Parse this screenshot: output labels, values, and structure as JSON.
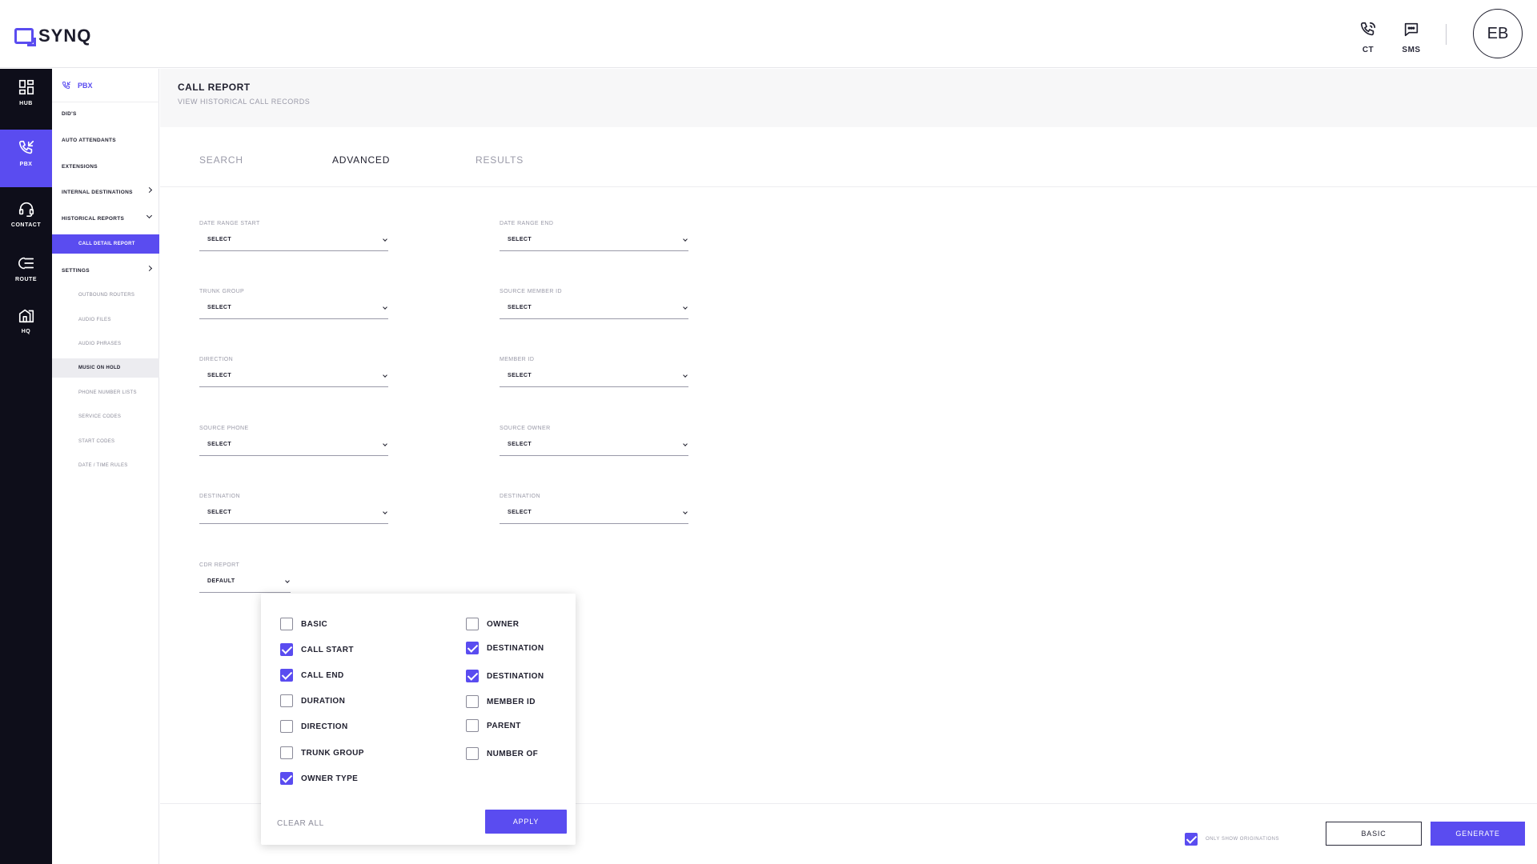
{
  "app": {
    "brand": "SYNQ",
    "brand_color": "#5a4cf0",
    "header_actions": [
      {
        "label": "CT",
        "icon": "phone-icon"
      },
      {
        "label": "SMS",
        "icon": "message-icon"
      }
    ],
    "avatar_initials": "EB"
  },
  "rail": {
    "items": [
      {
        "label": "HUB",
        "icon": "grid-icon",
        "active": false
      },
      {
        "label": "PBX",
        "icon": "incoming-call-icon",
        "active": true
      },
      {
        "label": "CONTACT",
        "icon": "headset-icon",
        "active": false
      },
      {
        "label": "ROUTE",
        "icon": "route-icon",
        "active": false
      },
      {
        "label": "HQ",
        "icon": "building-icon",
        "active": false
      }
    ]
  },
  "subnav": {
    "title": "PBX",
    "items": {
      "dids": "DID'S",
      "auto_attendants": "AUTO ATTENDANTS",
      "extensions": "EXTENSIONS",
      "internal_destinations": "INTERNAL DESTINATIONS",
      "historical_reports": "HISTORICAL REPORTS",
      "call_detail_report": "CALL DETAIL REPORT",
      "settings": "SETTINGS",
      "outbound_routers": "OUTBOUND ROUTERS",
      "audio_files": "AUDIO FILES",
      "audio_phrases": "AUDIO PHRASES",
      "music_on_hold": "MUSIC ON HOLD",
      "phone_number_lists": "PHONE NUMBER LISTS",
      "service_codes": "SERVICE CODES",
      "start_codes": "START CODES",
      "date_time_rules": "DATE / TIME RULES"
    }
  },
  "page": {
    "title": "CALL REPORT",
    "subtitle": "VIEW HISTORICAL CALL RECORDS",
    "tabs": {
      "search": "SEARCH",
      "advanced": "ADVANCED",
      "results": "RESULTS"
    }
  },
  "form": {
    "date_range_start": {
      "label": "DATE RANGE START",
      "value": "SELECT"
    },
    "date_range_end": {
      "label": "DATE RANGE END",
      "value": "SELECT"
    },
    "trunk_group": {
      "label": "TRUNK GROUP",
      "value": "SELECT"
    },
    "source_member_id": {
      "label": "SOURCE MEMBER ID",
      "value": "SELECT"
    },
    "direction": {
      "label": "DIRECTION",
      "value": "SELECT"
    },
    "member_id": {
      "label": "MEMBER ID",
      "value": "SELECT"
    },
    "source_phone": {
      "label": "SOURCE PHONE",
      "value": "SELECT"
    },
    "source_owner": {
      "label": "SOURCE OWNER",
      "value": "SELECT"
    },
    "destination_left": {
      "label": "DESTINATION",
      "value": "SELECT"
    },
    "destination_right": {
      "label": "DESTINATION",
      "value": "SELECT"
    },
    "cdr_report": {
      "label": "CDR REPORT",
      "value": "DEFAULT"
    }
  },
  "popup": {
    "options": {
      "basic": {
        "label": "BASIC",
        "checked": false
      },
      "call_start": {
        "label": "CALL START",
        "checked": true
      },
      "call_end": {
        "label": "CALL END",
        "checked": true
      },
      "duration": {
        "label": "DURATION",
        "checked": false
      },
      "direction": {
        "label": "DIRECTION",
        "checked": false
      },
      "trunk_group": {
        "label": "TRUNK GROUP",
        "checked": false
      },
      "owner_type": {
        "label": "OWNER TYPE",
        "checked": true
      },
      "owner": {
        "label": "OWNER",
        "checked": false
      },
      "destination_1": {
        "label": "DESTINATION",
        "checked": true
      },
      "destination_2": {
        "label": "DESTINATION",
        "checked": true
      },
      "member_id": {
        "label": "MEMBER ID",
        "checked": false
      },
      "parent": {
        "label": "PARENT",
        "checked": false
      },
      "number_of": {
        "label": "NUMBER OF",
        "checked": false
      }
    },
    "clear_all": "CLEAR ALL",
    "apply": "APPLY"
  },
  "footer": {
    "only_show_originations": "ONLY SHOW ORIGINATIONS",
    "only_show_originations_checked": true,
    "basic": "BASIC",
    "generate": "GENERATE"
  }
}
